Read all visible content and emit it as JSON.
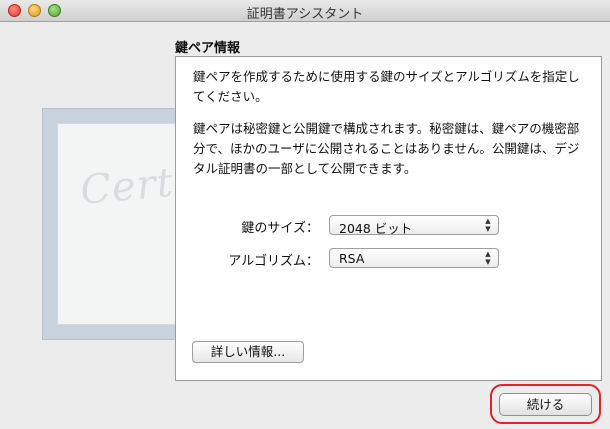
{
  "window": {
    "title": "証明書アシスタント"
  },
  "background": {
    "certificate_script": "Certificate"
  },
  "section": {
    "heading": "鍵ペア情報"
  },
  "panel": {
    "paragraph1": "鍵ペアを作成するために使用する鍵のサイズとアルゴリズムを指定してください。",
    "paragraph2": "鍵ペアは秘密鍵と公開鍵で構成されます。秘密鍵は、鍵ペアの機密部分で、ほかのユーザに公開されることはありません。公開鍵は、デジタル証明書の一部として公開できます。",
    "key_size": {
      "label": "鍵のサイズ：",
      "value": "2048 ビット"
    },
    "algorithm": {
      "label": "アルゴリズム：",
      "value": "RSA"
    },
    "details_button": "詳しい情報..."
  },
  "footer": {
    "continue_button": "続ける"
  },
  "colors": {
    "highlight_ring": "#e0242a",
    "traffic_close": "#d9362b",
    "traffic_minimize": "#d69b1f",
    "traffic_maximize": "#4ea52f"
  }
}
